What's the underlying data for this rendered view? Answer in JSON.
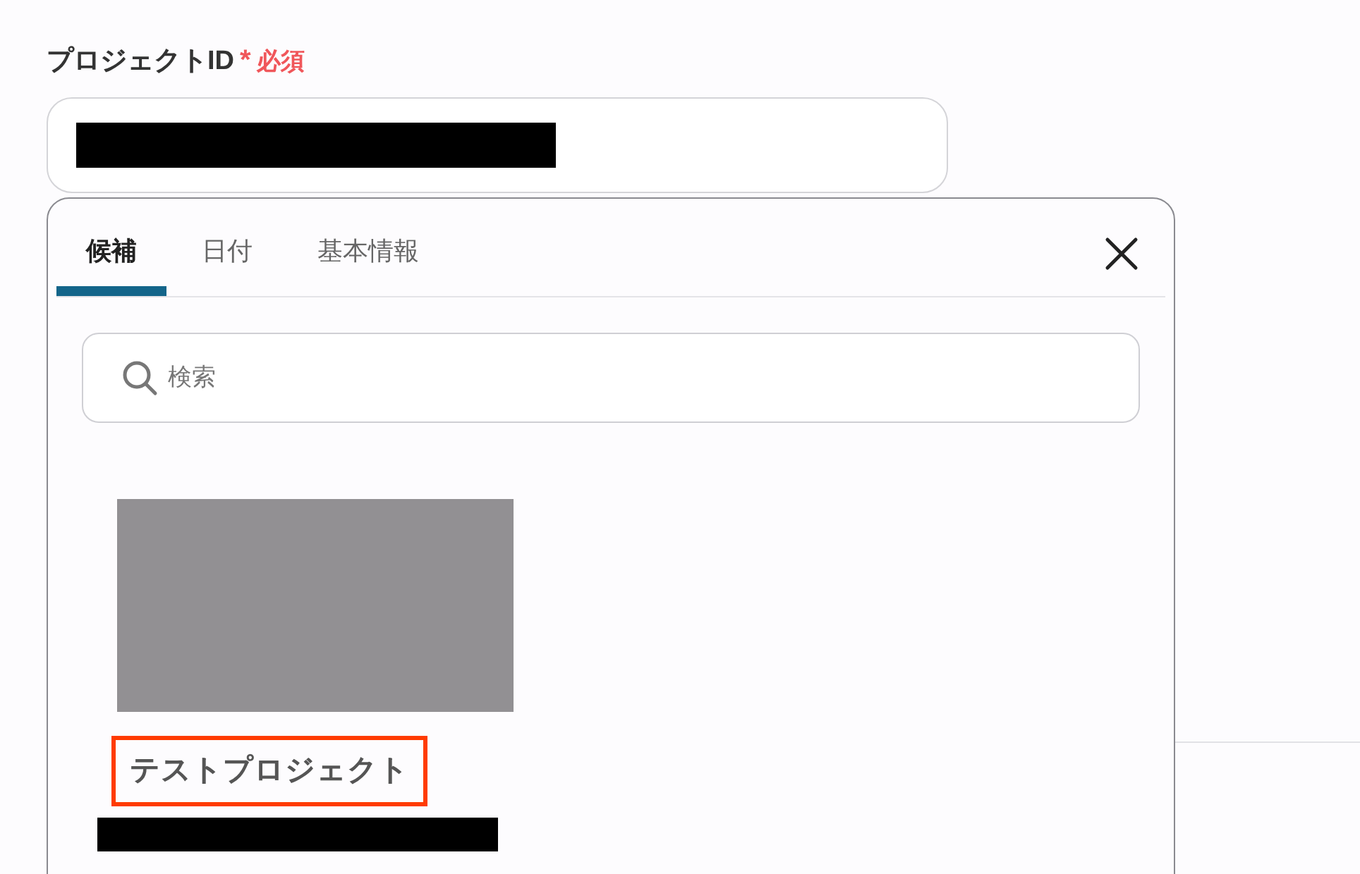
{
  "field": {
    "label": "プロジェクトID",
    "required_mark": "*",
    "required_label": "必須"
  },
  "popup": {
    "tabs": [
      {
        "label": "候補",
        "selected": true
      },
      {
        "label": "日付",
        "selected": false
      },
      {
        "label": "基本情報",
        "selected": false
      }
    ],
    "search": {
      "placeholder": "検索"
    },
    "candidates": [
      {
        "title": "テストプロジェクト",
        "highlighted": true
      }
    ]
  }
}
